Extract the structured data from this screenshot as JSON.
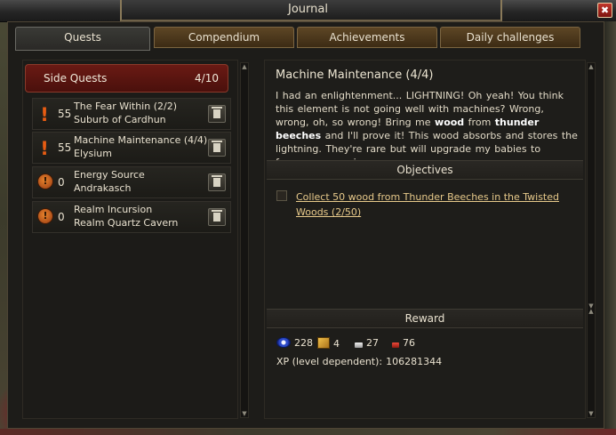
{
  "window": {
    "title": "Journal"
  },
  "tabs": [
    {
      "label": "Quests",
      "active": true
    },
    {
      "label": "Compendium",
      "active": false
    },
    {
      "label": "Achievements",
      "active": false
    },
    {
      "label": "Daily challenges",
      "active": false
    }
  ],
  "side_quests": {
    "label": "Side Quests",
    "count": "4/10"
  },
  "quests": [
    {
      "icon": "exclamation-icon",
      "level": "55",
      "name": "The Fear Within (2/2)",
      "zone": "Suburb of Cardhun"
    },
    {
      "icon": "exclamation-icon",
      "level": "55",
      "name": "Machine Maintenance (4/4)",
      "zone": "Elysium"
    },
    {
      "icon": "warning-circle-icon",
      "level": "0",
      "name": "Energy Source",
      "zone": "Andrakasch"
    },
    {
      "icon": "warning-circle-icon",
      "level": "0",
      "name": "Realm Incursion",
      "zone": "Realm Quartz Cavern"
    }
  ],
  "detail": {
    "title": "Machine Maintenance (4/4)",
    "description": {
      "part1": "I had an enlightenment... LIGHTNING! Oh yeah! You think this element is not going well with machines? Wrong, wrong, oh, so wrong! Bring me ",
      "hl1": "wood",
      "part2": " from ",
      "hl2": "thunder beeches",
      "part3": " and I'll prove it! This wood absorbs and stores the lightning. They're rare but will upgrade my babies to fearsome enemies."
    },
    "objectives_label": "Objectives",
    "objective": "Collect 50 wood from Thunder Beeches in the Twisted Woods (2/50)",
    "reward_label": "Reward",
    "rewards": {
      "eye": "228",
      "gold": "4",
      "silver": "27",
      "copper": "76"
    },
    "xp_label": "XP (level dependent):",
    "xp_value": "106281344"
  }
}
